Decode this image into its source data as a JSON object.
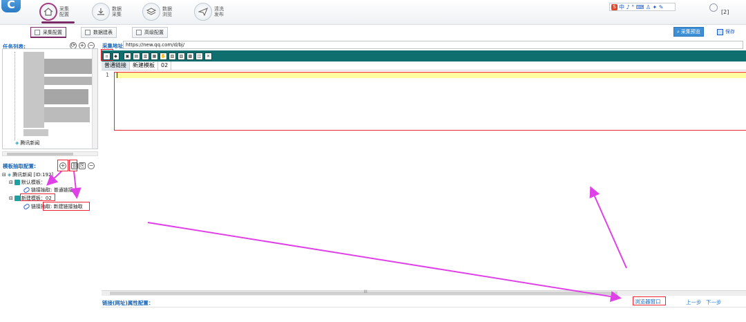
{
  "top_nav": {
    "logo": "logo-icon",
    "items": [
      {
        "l1": "采集",
        "l2": "配置"
      },
      {
        "l1": "数据",
        "l2": "采集"
      },
      {
        "l1": "数据",
        "l2": "浏览"
      },
      {
        "l1": "清洗",
        "l2": "发布"
      }
    ],
    "badge": "[2]"
  },
  "sub_toolbar": {
    "collect_config": "采集配置",
    "data_tables": "数据建表",
    "advanced_config": "高级配置",
    "collect_preview": "采集预览",
    "save": "保存"
  },
  "task_panel": {
    "title": "任务列表:",
    "last_item": "腾讯新闻"
  },
  "template_panel": {
    "title": "模板抽取配置:",
    "root": "腾讯新闻 [ID:192]",
    "default_template": "默认模板：",
    "link_extract_1": "链接抽取: 普通链接",
    "new_template": "新建模板：02",
    "link_extract_2": "链接抽取: 新建链接抽取"
  },
  "editor": {
    "address_label": "采集地址:",
    "address_value": "https://new.qq.com/d/bj/",
    "tabs": [
      "普通链接",
      "新建模板",
      "02"
    ],
    "line_number": "1",
    "scroll_marker": "III"
  },
  "bottom": {
    "link_config_label": "链接(网址)属性配置：",
    "browser_window": "浏览器窗口",
    "prev_step": "上一步",
    "next_step": "下一步"
  },
  "colors": {
    "accent_teal": "#0f6f6f",
    "link_blue": "#1a66b8",
    "annotation_red": "#e22233",
    "annotation_magenta": "#e040e8"
  }
}
